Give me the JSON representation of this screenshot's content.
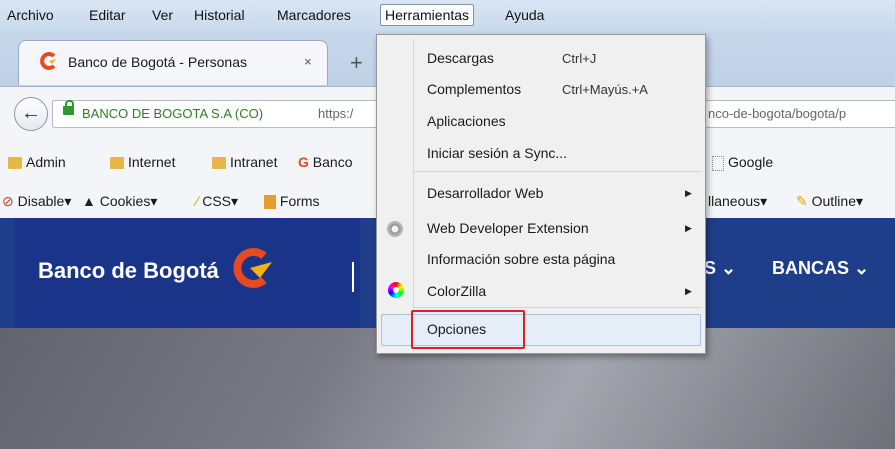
{
  "menubar": {
    "items": [
      "Archivo",
      "Editar",
      "Ver",
      "Historial",
      "Marcadores",
      "Herramientas",
      "Ayuda"
    ]
  },
  "tab": {
    "title": "Banco de Bogotá - Personas",
    "close": "×",
    "new": "+"
  },
  "nav": {
    "back": "←",
    "identity": "BANCO DE BOGOTA S.A (CO)",
    "url_start": "https:/",
    "url_end": "nco-de-bogota/bogota/p"
  },
  "bookmarks": {
    "items": [
      "Admin",
      "Internet",
      "Intranet",
      "Banco",
      "Google"
    ]
  },
  "toolbar": {
    "items": [
      "Disable",
      "Cookies",
      "CSS",
      "Forms",
      "llaneous",
      "Outline"
    ]
  },
  "page": {
    "brand": "Banco de Bogotá",
    "nav_partial": "S ⌄",
    "nav_bancas": "BANCAS ⌄"
  },
  "menu": {
    "items": [
      {
        "label": "Descargas",
        "shortcut": "Ctrl+J"
      },
      {
        "label": "Complementos",
        "shortcut": "Ctrl+Mayús.+A"
      },
      {
        "label": "Aplicaciones",
        "shortcut": ""
      },
      {
        "label": "Iniciar sesión a Sync...",
        "shortcut": ""
      },
      {
        "label": "Desarrollador Web",
        "shortcut": ""
      },
      {
        "label": "Web Developer Extension",
        "shortcut": ""
      },
      {
        "label": "Información sobre esta página",
        "shortcut": ""
      },
      {
        "label": "ColorZilla",
        "shortcut": ""
      },
      {
        "label": "Opciones",
        "shortcut": ""
      }
    ],
    "submenu_arrow": "▶",
    "highlight_color": "#e02020"
  }
}
